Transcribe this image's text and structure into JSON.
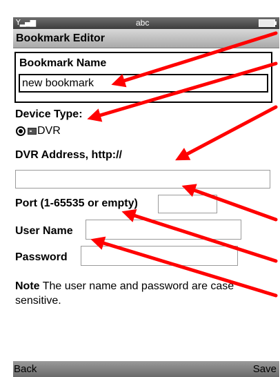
{
  "status_bar": {
    "signal_icon": "signal-strength-icon",
    "mode_text": "abc",
    "battery_icon": "battery-icon"
  },
  "title": "Bookmark Editor",
  "form": {
    "bookmark_name": {
      "label": "Bookmark Name",
      "value": "new bookmark"
    },
    "device_type": {
      "label": "Device Type:",
      "selected_option": "DVR",
      "option_icon": "dvr-icon"
    },
    "dvr_address": {
      "label": "DVR Address, http://",
      "value": ""
    },
    "port": {
      "label": "Port (1-65535 or empty)",
      "value": ""
    },
    "user_name": {
      "label": "User Name",
      "value": ""
    },
    "password": {
      "label": "Password",
      "value": ""
    },
    "note": {
      "label": "Note",
      "text": "The user name and password are case sensitive."
    }
  },
  "softkeys": {
    "left": "Back",
    "right": "Save"
  },
  "annotation_color": "#ff0000"
}
